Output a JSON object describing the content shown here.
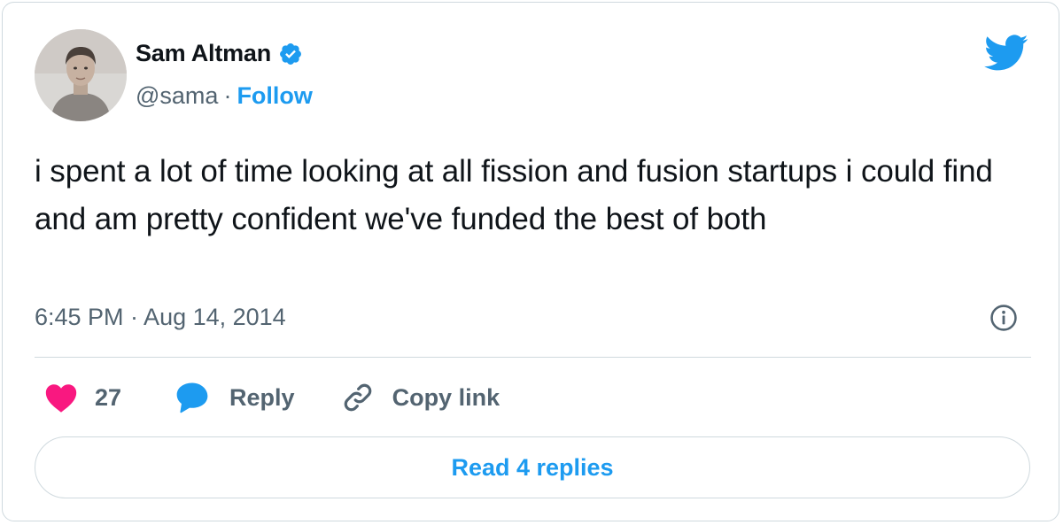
{
  "author": {
    "name": "Sam Altman",
    "handle": "@sama",
    "separator": "·",
    "follow_label": "Follow",
    "verified": true
  },
  "tweet": {
    "text": "i spent a lot of time looking at all fission and fusion startups i could find and am pretty confident we've funded the best of both",
    "timestamp": "6:45 PM · Aug 14, 2014"
  },
  "actions": {
    "like_count": "27",
    "reply_label": "Reply",
    "copy_link_label": "Copy link"
  },
  "read_replies_label": "Read 4 replies",
  "icons": {
    "brand": "twitter-bird-icon",
    "verified": "verified-badge-icon",
    "info": "info-icon",
    "like": "heart-icon",
    "reply": "reply-bubble-icon",
    "copy": "link-icon"
  },
  "colors": {
    "accent": "#1d9bf0",
    "like": "#f91880",
    "text": "#0f1419",
    "secondary": "#536471",
    "border": "#cfd9de"
  }
}
